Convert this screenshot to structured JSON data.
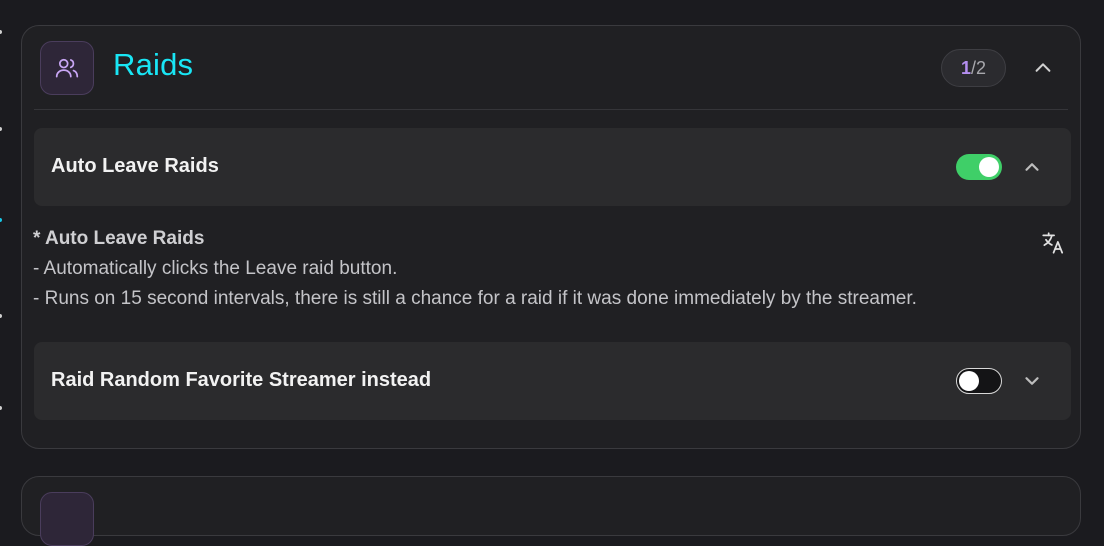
{
  "panel": {
    "title": "Raids",
    "icon": "users-icon",
    "counter": {
      "current": "1",
      "separator": "/",
      "total": "2"
    },
    "expanded": true,
    "title_color": "#19e6f5",
    "accent_color": "#b48ef0"
  },
  "settings": [
    {
      "label": "Auto Leave Raids",
      "enabled": true,
      "expanded": true
    },
    {
      "label": "Raid Random Favorite Streamer instead",
      "enabled": false,
      "expanded": false
    }
  ],
  "description": {
    "title": "* Auto Leave Raids",
    "lines": [
      "- Automatically clicks the Leave raid button.",
      "- Runs on 15 second intervals, there is still a chance for a raid if it was done immediately by the streamer."
    ],
    "translate_icon": "translate-icon"
  },
  "colors": {
    "toggle_on": "#3fcf68",
    "background": "#1b1b1f",
    "panel": "#202023"
  }
}
